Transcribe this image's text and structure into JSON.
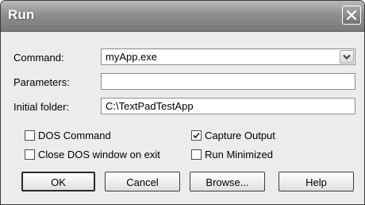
{
  "window": {
    "title": "Run"
  },
  "form": {
    "command_label": "Command:",
    "command_value": "myApp.exe",
    "parameters_label": "Parameters:",
    "parameters_value": "",
    "initial_folder_label": "Initial folder:",
    "initial_folder_value": "C:\\TextPadTestApp"
  },
  "options": {
    "dos_command": {
      "label": "DOS Command",
      "checked": false
    },
    "capture_output": {
      "label": "Capture Output",
      "checked": true
    },
    "close_dos_window": {
      "label": "Close DOS window on exit",
      "checked": false
    },
    "run_minimized": {
      "label": "Run Minimized",
      "checked": false
    }
  },
  "buttons": {
    "ok": "OK",
    "cancel": "Cancel",
    "browse": "Browse...",
    "help": "Help"
  },
  "icons": {
    "close": "close-icon",
    "dropdown": "chevron-down-icon",
    "check": "checkmark-icon"
  },
  "colors": {
    "titlebar": "#8f8f8f",
    "dialog_bg": "#ececec",
    "field_bg": "#ffffff"
  }
}
